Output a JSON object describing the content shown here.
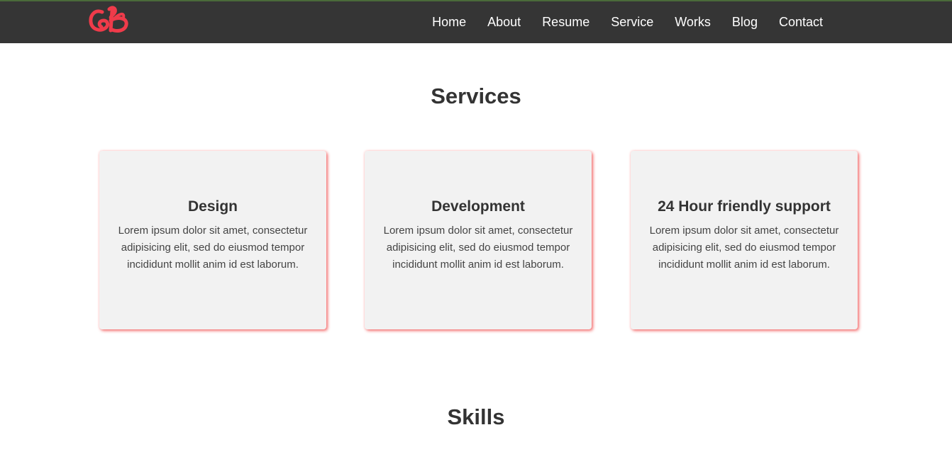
{
  "colors": {
    "navbar_bg": "#353535",
    "brand_red": "#ef3b4a",
    "card_bg": "#f2f2f2",
    "card_shadow": "#f04646"
  },
  "logo": {
    "icon": "brand-logo-icon",
    "text": "CB"
  },
  "nav": {
    "items": [
      {
        "label": "Home"
      },
      {
        "label": "About"
      },
      {
        "label": "Resume"
      },
      {
        "label": "Service"
      },
      {
        "label": "Works"
      },
      {
        "label": "Blog"
      },
      {
        "label": "Contact"
      }
    ]
  },
  "services": {
    "title": "Services",
    "cards": [
      {
        "title": "Design",
        "text": "Lorem ipsum dolor sit amet, consectetur adipisicing elit, sed do eiusmod tempor incididunt mollit anim id est laborum."
      },
      {
        "title": "Development",
        "text": "Lorem ipsum dolor sit amet, consectetur adipisicing elit, sed do eiusmod tempor incididunt mollit anim id est laborum."
      },
      {
        "title": "24 Hour friendly support",
        "text": "Lorem ipsum dolor sit amet, consectetur adipisicing elit, sed do eiusmod tempor incididunt mollit anim id est laborum."
      }
    ]
  },
  "skills": {
    "title": "Skills"
  }
}
